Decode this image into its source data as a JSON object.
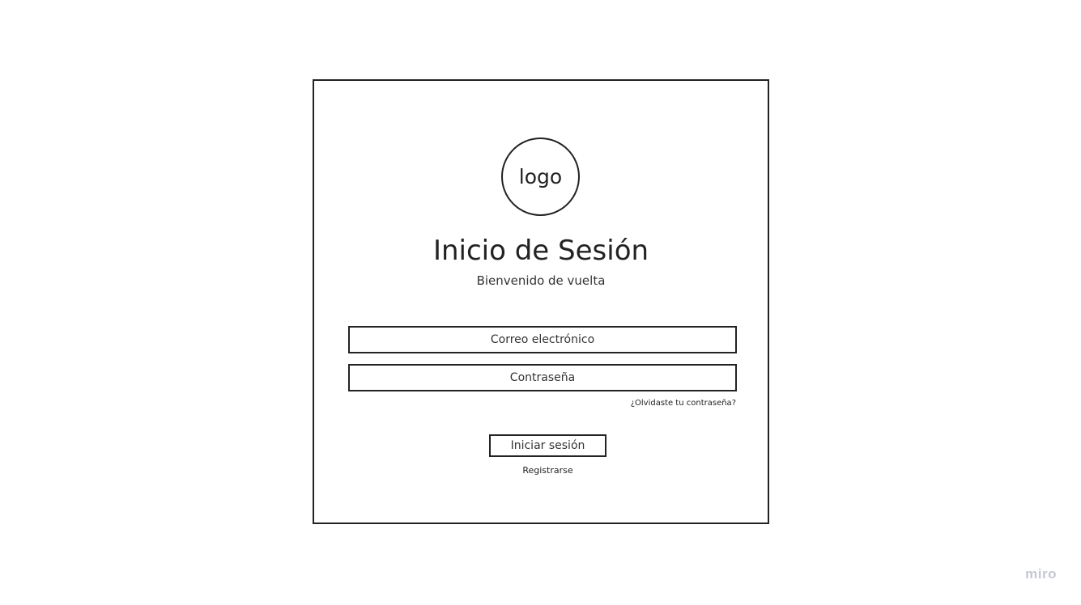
{
  "logo": {
    "text": "logo"
  },
  "header": {
    "title": "Inicio de Sesión",
    "subtitle": "Bienvenido de vuelta"
  },
  "form": {
    "email_placeholder": "Correo electrónico",
    "password_placeholder": "Contraseña",
    "forgot_link": "¿Olvidaste tu contraseña?",
    "login_button": "Iniciar sesión",
    "register_link": "Registrarse"
  },
  "watermark": {
    "text": "miro"
  },
  "colors": {
    "stroke": "#222222",
    "text": "#333333",
    "watermark": "#c5c8d2",
    "background": "#ffffff"
  }
}
